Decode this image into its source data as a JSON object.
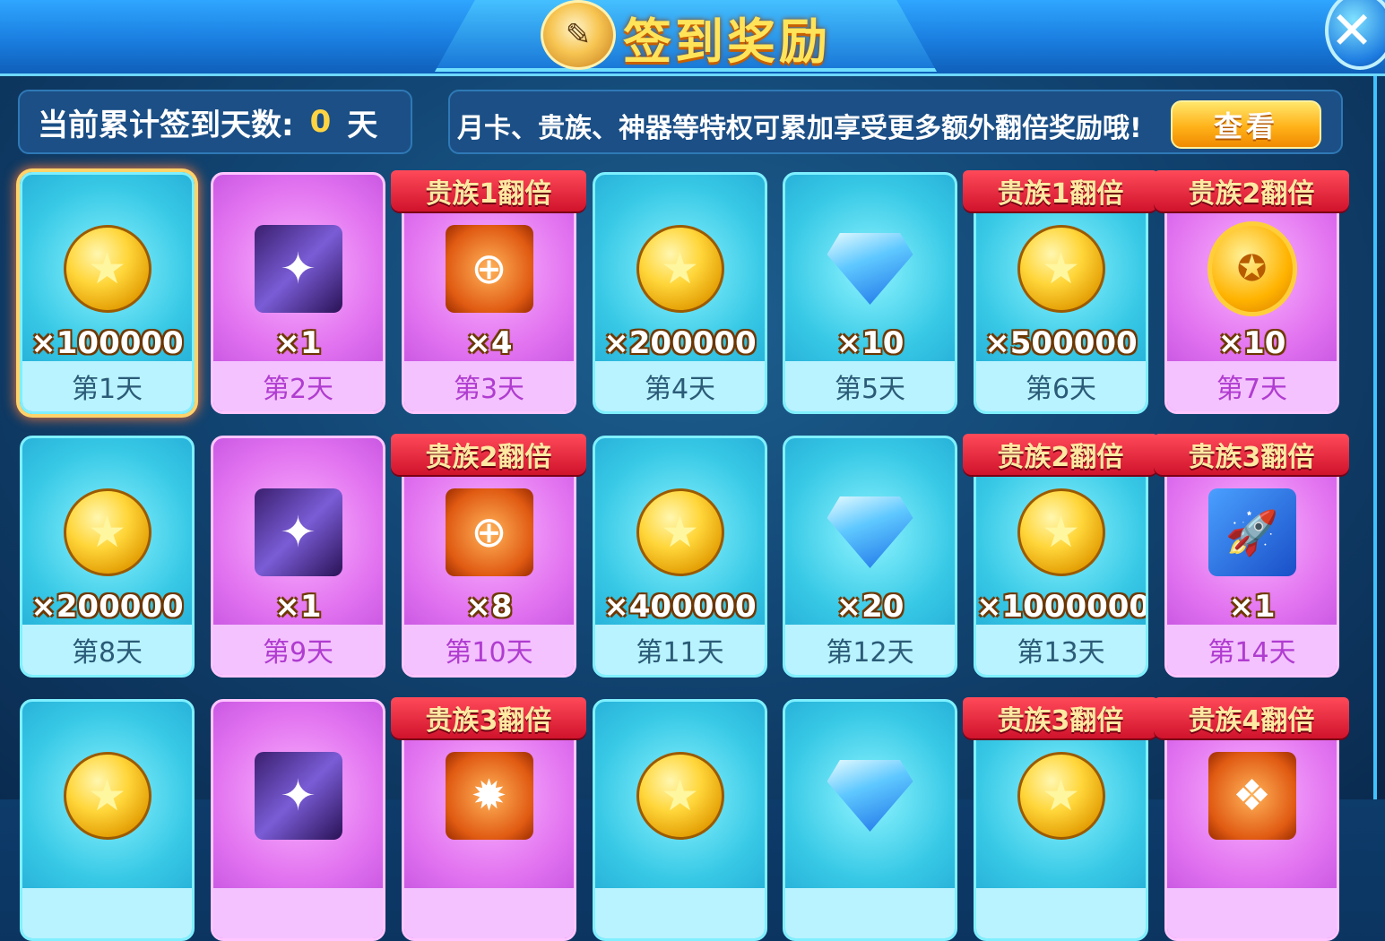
{
  "header": {
    "title": "签到奖励",
    "title_icon": "checklist-pencil-icon",
    "close_label": "✕"
  },
  "summary": {
    "label": "当前累计签到天数:",
    "days": "0",
    "unit": "天"
  },
  "notice": {
    "text": "月卡、贵族、神器等特权可累加享受更多额外翻倍奖励哦!",
    "button_label": "查看"
  },
  "cards": [
    {
      "day": "第1天",
      "amount": "×100000",
      "item": "coin-icon",
      "color": "teal",
      "ribbon": "",
      "selected": true
    },
    {
      "day": "第2天",
      "amount": "×1",
      "item": "wings-icon",
      "color": "purple",
      "ribbon": ""
    },
    {
      "day": "第3天",
      "amount": "×4",
      "item": "target-icon",
      "color": "purple",
      "ribbon": "贵族1翻倍"
    },
    {
      "day": "第4天",
      "amount": "×200000",
      "item": "coin-icon",
      "color": "teal",
      "ribbon": ""
    },
    {
      "day": "第5天",
      "amount": "×10",
      "item": "diamond-icon",
      "color": "teal",
      "ribbon": ""
    },
    {
      "day": "第6天",
      "amount": "×500000",
      "item": "coin-icon",
      "color": "teal",
      "ribbon": "贵族1翻倍"
    },
    {
      "day": "第7天",
      "amount": "×10",
      "item": "medal-icon",
      "color": "purple",
      "ribbon": "贵族2翻倍"
    },
    {
      "day": "第8天",
      "amount": "×200000",
      "item": "coin-icon",
      "color": "teal",
      "ribbon": ""
    },
    {
      "day": "第9天",
      "amount": "×1",
      "item": "wings-icon",
      "color": "purple",
      "ribbon": ""
    },
    {
      "day": "第10天",
      "amount": "×8",
      "item": "target-icon",
      "color": "purple",
      "ribbon": "贵族2翻倍"
    },
    {
      "day": "第11天",
      "amount": "×400000",
      "item": "coin-icon",
      "color": "teal",
      "ribbon": ""
    },
    {
      "day": "第12天",
      "amount": "×20",
      "item": "diamond-icon",
      "color": "teal",
      "ribbon": ""
    },
    {
      "day": "第13天",
      "amount": "×1000000",
      "item": "coin-icon",
      "color": "teal",
      "ribbon": "贵族2翻倍"
    },
    {
      "day": "第14天",
      "amount": "×1",
      "item": "rocket-icon",
      "color": "purple",
      "ribbon": "贵族3翻倍"
    },
    {
      "day": "",
      "amount": "",
      "item": "coin-icon",
      "color": "teal",
      "ribbon": ""
    },
    {
      "day": "",
      "amount": "",
      "item": "wings-icon",
      "color": "purple",
      "ribbon": ""
    },
    {
      "day": "",
      "amount": "",
      "item": "fire-icon",
      "color": "purple",
      "ribbon": "贵族3翻倍"
    },
    {
      "day": "",
      "amount": "",
      "item": "coin-icon",
      "color": "teal",
      "ribbon": ""
    },
    {
      "day": "",
      "amount": "",
      "item": "diamond-icon",
      "color": "teal",
      "ribbon": ""
    },
    {
      "day": "",
      "amount": "",
      "item": "coin-icon",
      "color": "teal",
      "ribbon": "贵族3翻倍"
    },
    {
      "day": "",
      "amount": "",
      "item": "crystal-icon",
      "color": "purple",
      "ribbon": "贵族4翻倍"
    }
  ]
}
